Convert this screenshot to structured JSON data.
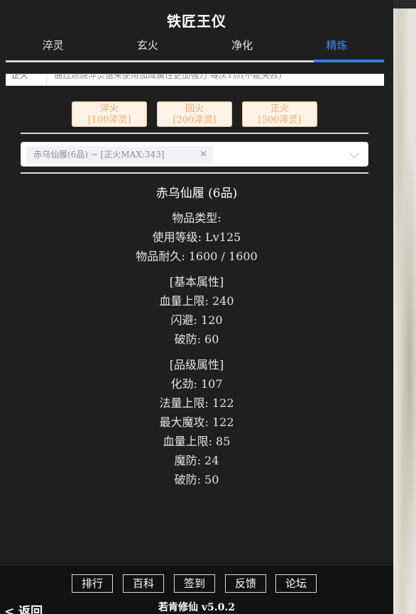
{
  "window": {
    "title": "铁匠王仪"
  },
  "tabs": [
    {
      "label": "淬灵"
    },
    {
      "label": "玄火"
    },
    {
      "label": "净化"
    },
    {
      "label": "精炼"
    }
  ],
  "active_tab_color": "#3b8cff",
  "tip": {
    "label": "正火",
    "text": "通过燃烧淬灵值来使用加成属性更加强力 每次1点(不能失败)"
  },
  "fire_buttons": [
    {
      "name": "淬火",
      "cost": "[100淬灵]"
    },
    {
      "name": "回火",
      "cost": "[200淬灵]"
    },
    {
      "name": "正火",
      "cost": "[500淬灵]"
    }
  ],
  "select": {
    "tag": "赤乌仙履(6品) ~ [正火MAX:343]",
    "close": "×"
  },
  "item": {
    "name": "赤乌仙履 (6品)",
    "type_line": "物品类型:",
    "level_line": "使用等级: Lv125",
    "durability_line": "物品耐久: 1600 / 1600",
    "base_header": "[基本属性]",
    "base_attrs": [
      "血量上限: 240",
      "闪避: 120",
      "破防: 60"
    ],
    "grade_header": "[品级属性]",
    "grade_attrs": [
      "化劲: 107",
      "法量上限: 122",
      "最大魔攻: 122",
      "血量上限: 85",
      "魔防: 24",
      "破防: 50"
    ]
  },
  "footer": {
    "buttons": [
      "排行",
      "百科",
      "签到",
      "反馈",
      "论坛"
    ],
    "back": "< 返回",
    "version": "若肯修仙 v5.0.2"
  }
}
